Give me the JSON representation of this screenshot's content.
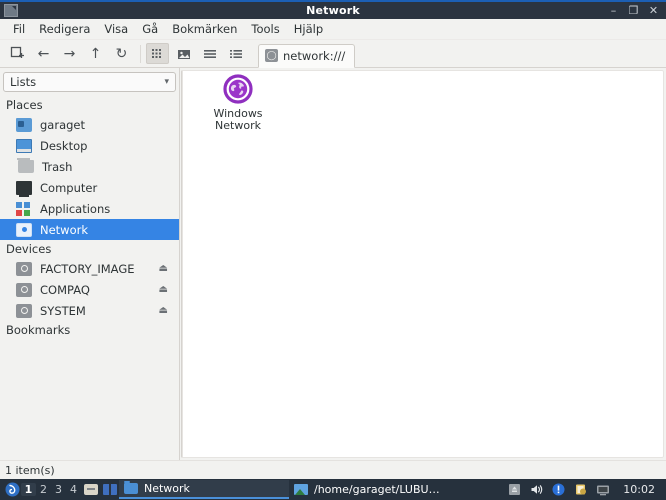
{
  "window": {
    "title": "Network",
    "icon": "file-manager-icon",
    "buttons": {
      "minimize": "–",
      "maximize": "❐",
      "close": "✕"
    }
  },
  "menubar": {
    "items": [
      {
        "label": "Fil"
      },
      {
        "label": "Redigera"
      },
      {
        "label": "Visa"
      },
      {
        "label": "Gå"
      },
      {
        "label": "Bokmärken"
      },
      {
        "label": "Tools"
      },
      {
        "label": "Hjälp"
      }
    ]
  },
  "toolbar": {
    "new_tab": "new-tab-icon",
    "back": "←",
    "forward": "→",
    "up": "↑",
    "reload": "↻",
    "view_icons": "grid-view-icon",
    "view_thumbnails": "thumbnail-view-icon",
    "view_compact": "compact-view-icon",
    "view_detailed": "detailed-list-view-icon"
  },
  "tab": {
    "label": "network:///",
    "icon_glyph": "◯"
  },
  "sidebar": {
    "combo": {
      "value": "Lists",
      "chevron": "▾"
    },
    "groups": [
      {
        "header": "Places",
        "items": [
          {
            "label": "garaget",
            "icon": "folder-icon",
            "selected": false
          },
          {
            "label": "Desktop",
            "icon": "desktop-icon",
            "selected": false
          },
          {
            "label": "Trash",
            "icon": "trash-icon",
            "selected": false
          },
          {
            "label": "Computer",
            "icon": "computer-icon",
            "selected": false
          },
          {
            "label": "Applications",
            "icon": "applications-icon",
            "selected": false
          },
          {
            "label": "Network",
            "icon": "network-icon",
            "selected": true
          }
        ]
      },
      {
        "header": "Devices",
        "items": [
          {
            "label": "FACTORY_IMAGE",
            "icon": "drive-icon",
            "eject": "⏏"
          },
          {
            "label": "COMPAQ",
            "icon": "drive-icon",
            "eject": "⏏"
          },
          {
            "label": "SYSTEM",
            "icon": "drive-icon",
            "eject": "⏏"
          }
        ]
      },
      {
        "header": "Bookmarks",
        "items": []
      }
    ]
  },
  "content": {
    "items": [
      {
        "name": "Windows\nNetwork",
        "name_line1": "Windows",
        "name_line2": "Network",
        "icon": "windows-network-globe-icon"
      }
    ]
  },
  "statusbar": {
    "text": "1 item(s)"
  },
  "taskbar": {
    "start_icon": "lubuntu-start-icon",
    "desktops": [
      {
        "label": "1",
        "active": true
      },
      {
        "label": "2",
        "active": false
      },
      {
        "label": "3",
        "active": false
      },
      {
        "label": "4",
        "active": false
      }
    ],
    "launchers": [
      {
        "name": "file-manager-launcher-icon"
      },
      {
        "name": "text-editor-launcher-icon"
      }
    ],
    "tasks": [
      {
        "label": "Network",
        "icon": "folder-icon",
        "active": true
      },
      {
        "label": "/home/garaget/LUBU…",
        "icon": "image-viewer-icon",
        "active": false
      }
    ],
    "tray": [
      {
        "name": "keyboard-layout-icon"
      },
      {
        "name": "volume-icon"
      },
      {
        "name": "update-notifier-icon"
      },
      {
        "name": "clipboard-icon"
      },
      {
        "name": "network-monitor-icon"
      }
    ],
    "clock": "10:02"
  },
  "colors": {
    "accent": "#3584e4",
    "titlebar_bg": "#2b3440",
    "taskbar_bg": "#26313d",
    "chrome_bg": "#f2f2f0",
    "network_purple": "#8f2fbf"
  }
}
